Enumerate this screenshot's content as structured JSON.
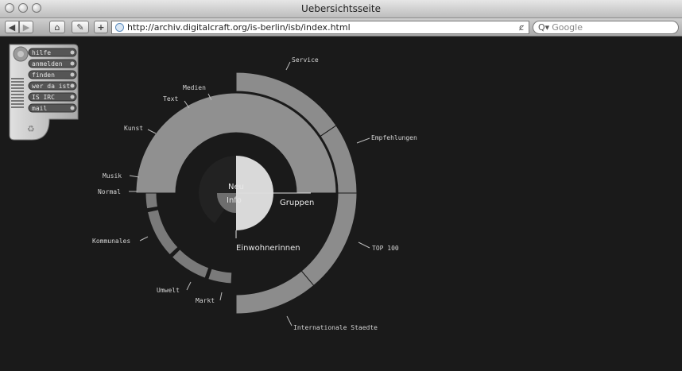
{
  "window": {
    "title": "Uebersichtsseite"
  },
  "toolbar": {
    "back": "◀",
    "forward": "▶",
    "home": "⌂",
    "edit": "✎",
    "add": "+",
    "url": "http://archiv.digitalcraft.org/is-berlin/isb/index.html",
    "reload": "ȼ",
    "search_prefix": "Q▾",
    "search_placeholder": "Google"
  },
  "sidebar": {
    "items": [
      {
        "label": "hilfe"
      },
      {
        "label": "anmelden"
      },
      {
        "label": "finden"
      },
      {
        "label": "wer da ist"
      },
      {
        "label": "IS IRC"
      },
      {
        "label": "mail"
      }
    ]
  },
  "wheel": {
    "center": {
      "neu": "Neu",
      "info": "Info",
      "gruppen": "Gruppen",
      "einwohnerinnen": "Einwohnerinnen"
    },
    "categories": {
      "service": "Service",
      "empfehlungen": "Empfehlungen",
      "top100": "TOP 100",
      "internationale": "Internationale Staedte",
      "medien": "Medien",
      "text": "Text",
      "kunst": "Kunst",
      "musik": "Musik",
      "normal": "Normal",
      "kommunales": "Kommunales",
      "umwelt": "Umwelt",
      "markt": "Markt"
    }
  },
  "colors": {
    "background": "#1a1a1a",
    "ring": "#8c8c8c",
    "ring_dark": "#7a7a7a",
    "center_light": "#d9d9d9",
    "center_dark": "#6e6e6e",
    "label": "#d4d4d4"
  }
}
